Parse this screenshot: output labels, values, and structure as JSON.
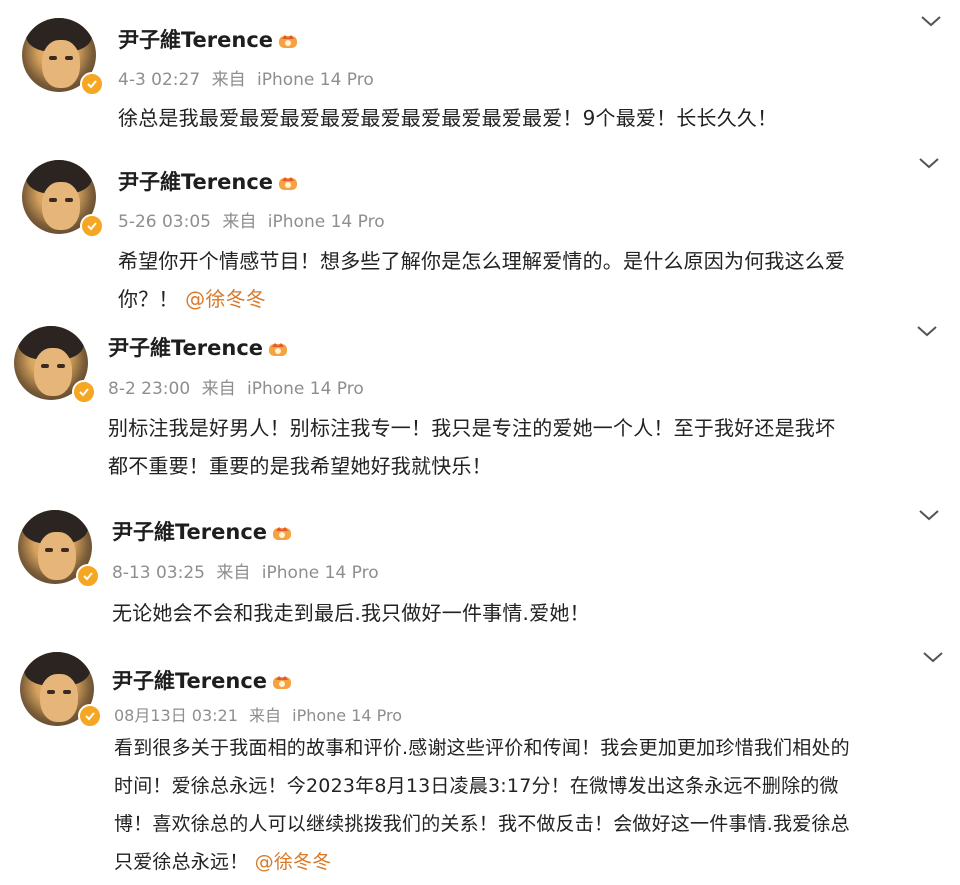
{
  "posts": [
    {
      "username": "尹子維Terence",
      "date": "4-3 02:27",
      "source_prefix": "来自",
      "source_device": "iPhone 14 Pro",
      "lines": [
        "徐总是我最爱最爱最爱最爱最爱最爱最爱最爱最爱！9个最爱！长长久久！"
      ],
      "mention": ""
    },
    {
      "username": "尹子維Terence",
      "date": "5-26 03:05",
      "source_prefix": "来自",
      "source_device": "iPhone 14 Pro",
      "lines": [
        "希望你开个情感节目！想多些了解你是怎么理解爱情的。是什么原因为何我这么爱",
        "你？！"
      ],
      "mention": "@徐冬冬"
    },
    {
      "username": "尹子維Terence",
      "date": "8-2 23:00",
      "source_prefix": "来自",
      "source_device": "iPhone 14 Pro",
      "lines": [
        "别标注我是好男人！别标注我专一！我只是专注的爱她一个人！至于我好还是我坏",
        "都不重要！重要的是我希望她好我就快乐！"
      ],
      "mention": ""
    },
    {
      "username": "尹子維Terence",
      "date": "8-13 03:25",
      "source_prefix": "来自",
      "source_device": "iPhone 14 Pro",
      "lines": [
        "无论她会不会和我走到最后.我只做好一件事情.爱她！"
      ],
      "mention": ""
    },
    {
      "username": "尹子維Terence",
      "date": "08月13日 03:21",
      "source_prefix": "来自",
      "source_device": "iPhone 14 Pro",
      "lines": [
        "看到很多关于我面相的故事和评价.感谢这些评价和传闻！我会更加更加珍惜我们相处的",
        "时间！爱徐总永远！今2023年8月13日凌晨3:17分！在微博发出这条永远不删除的微",
        "博！喜欢徐总的人可以继续挑拨我们的关系！我不做反击！会做好这一件事情.我爱徐总",
        "只爱徐总永远！"
      ],
      "mention": "@徐冬冬"
    }
  ],
  "icons": {
    "verified_badge": "verified-check-icon",
    "vip_crown": "vip-crown-icon",
    "expand": "chevron-down-icon"
  },
  "colors": {
    "mention": "#d97a2b",
    "meta_text": "#8e8e8e",
    "badge": "#f5a623"
  }
}
